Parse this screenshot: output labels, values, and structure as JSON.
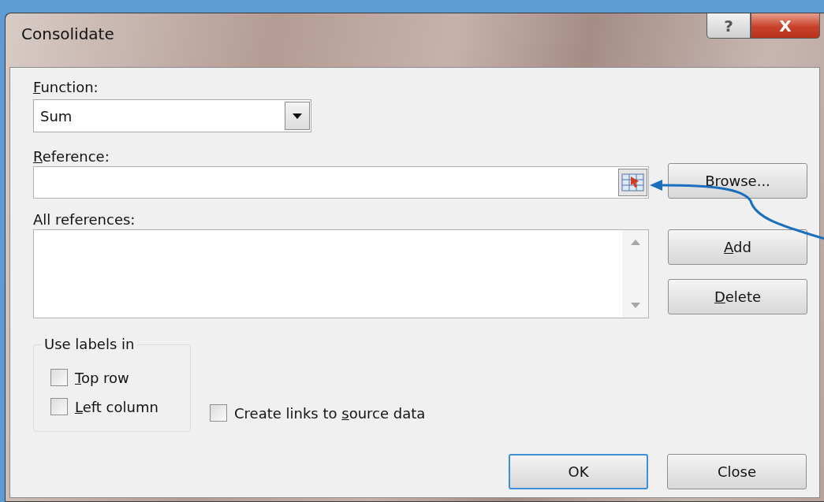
{
  "window": {
    "title": "Consolidate",
    "title_buttons": [
      {
        "kind": "help",
        "label": "?"
      },
      {
        "kind": "close",
        "label": "X"
      }
    ]
  },
  "function": {
    "label": {
      "key": "F",
      "after": "unction:"
    },
    "value": "Sum"
  },
  "reference": {
    "label": {
      "key": "R",
      "after": "eference:"
    }
  },
  "browse_button": {
    "label": "Browse..."
  },
  "all_references": {
    "label": "All references:"
  },
  "side_buttons": [
    {
      "key": "A",
      "after": "dd"
    },
    {
      "key": "D",
      "after": "elete"
    }
  ],
  "use_labels_in": {
    "title": "Use labels in",
    "options": [
      {
        "key": "T",
        "after": "op row",
        "checked": false
      },
      {
        "key": "L",
        "after": "eft column",
        "checked": false
      }
    ]
  },
  "create_links": {
    "before": "Create links to ",
    "key": "s",
    "after": "ource data",
    "checked": false
  },
  "footer_buttons": [
    {
      "label": "OK",
      "selected": true
    },
    {
      "label": "Close",
      "selected": false
    }
  ]
}
